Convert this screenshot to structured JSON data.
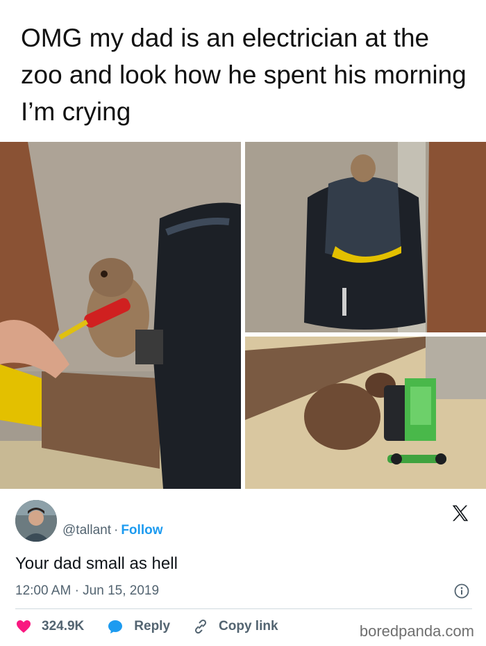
{
  "headline": "OMG my dad is an electrician at the zoo and look how he spent his morning I’m crying",
  "tweet": {
    "handle": "@tallant",
    "separator": "·",
    "follow_label": "Follow",
    "text": "Your dad small as hell",
    "time": "12:00 AM",
    "date": "Jun 15, 2019",
    "likes": "324.9K",
    "reply_label": "Reply",
    "copy_link_label": "Copy link"
  },
  "watermark": "boredpanda.com",
  "colors": {
    "like_red": "#f91880",
    "reply_blue": "#1d9bf0",
    "follow_blue": "#1d9bf0",
    "muted_text": "#536471"
  },
  "icons": [
    "x-logo-icon",
    "info-icon",
    "heart-icon",
    "reply-bubble-icon",
    "link-icon"
  ]
}
